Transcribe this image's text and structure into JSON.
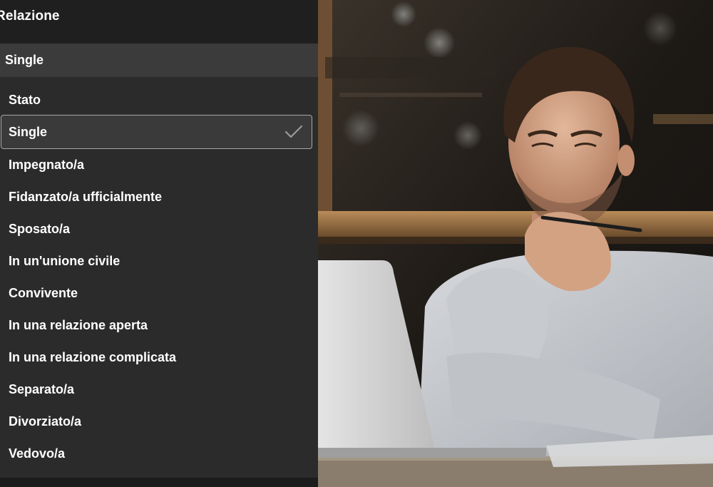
{
  "panel": {
    "title": "Relazione",
    "selected_value": "Single",
    "options": [
      {
        "label": "Stato",
        "header": true
      },
      {
        "label": "Single",
        "selected": true
      },
      {
        "label": "Impegnato/a"
      },
      {
        "label": "Fidanzato/a ufficialmente"
      },
      {
        "label": "Sposato/a"
      },
      {
        "label": "In un'unione civile"
      },
      {
        "label": "Convivente"
      },
      {
        "label": "In una relazione aperta"
      },
      {
        "label": "In una relazione complicata"
      },
      {
        "label": "Separato/a"
      },
      {
        "label": "Divorziato/a"
      },
      {
        "label": "Vedovo/a"
      }
    ],
    "check_icon": "checkmark-icon"
  },
  "colors": {
    "panel_bg": "#1f1f1f",
    "dropdown_bg": "#2b2b2b",
    "select_bg": "#3b3b3b",
    "selected_border": "#a8a8a8",
    "text": "#ffffff"
  }
}
